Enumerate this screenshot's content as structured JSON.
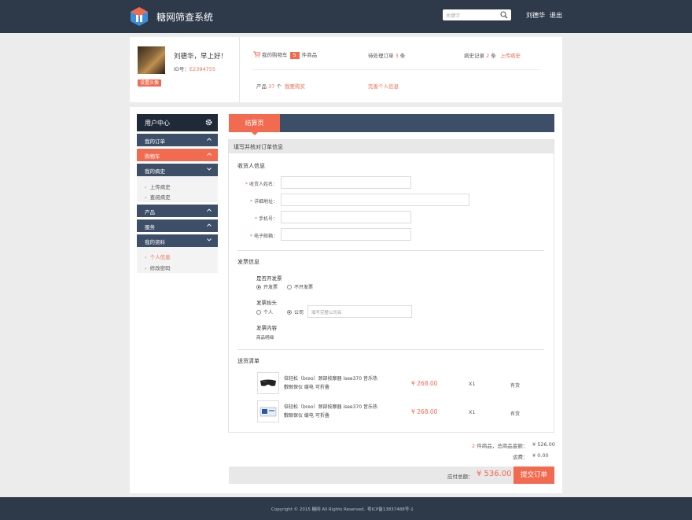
{
  "header": {
    "brand": "糖网筛查系统",
    "search_placeholder": "关键字",
    "username": "刘德华",
    "logout": "退出"
  },
  "profile": {
    "greeting": "刘德华，早上好！",
    "id_label": "ID号：",
    "id_value": "E2394755",
    "set_avatar": "设置头像"
  },
  "stats": {
    "cart_label": "我的购物车",
    "cart_count": "5",
    "cart_suffix": "件商品",
    "pending_label": "待处理订单",
    "pending_count": "3",
    "pending_unit": "条",
    "history_label": "病史记录",
    "history_count": "2",
    "history_unit": "条",
    "upload_link": "上传病史",
    "product_label": "产品",
    "product_count": "37",
    "product_unit": "个",
    "buy_link": "我要购买",
    "complete_link": "完善个人信息"
  },
  "sidebar": {
    "title": "用户中心",
    "items": [
      {
        "label": "我的订单"
      },
      {
        "label": "购物车"
      },
      {
        "label": "我的病史"
      },
      {
        "label": "上传病史"
      },
      {
        "label": "查阅病史"
      },
      {
        "label": "产品"
      },
      {
        "label": "服务"
      },
      {
        "label": "我的资料"
      },
      {
        "label": "个人信息"
      },
      {
        "label": "修改密码"
      }
    ]
  },
  "tab": {
    "label": "结算页"
  },
  "form": {
    "heading": "填写并核对订单信息",
    "receiver_title": "收货人信息",
    "fields": [
      {
        "label": "收货人姓名："
      },
      {
        "label": "详细地址："
      },
      {
        "label": "手机号："
      },
      {
        "label": "电子邮箱："
      }
    ],
    "invoice_title": "发票信息",
    "invoice_q": "是否开发票",
    "opt_yes": "开发票",
    "opt_no": "不开发票",
    "header_q": "发票抬头",
    "opt_personal": "个人",
    "opt_company": "公司",
    "company_placeholder": "填写完整公司名",
    "content_q": "发票内容",
    "content_value": "商品明细"
  },
  "delivery": {
    "title": "送货清单",
    "items": [
      {
        "name_line1": "倍轻松（breo）颈部按摩器 isee370 音乐热",
        "name_line2": "敷眼保仪 缓电 可折叠",
        "price": "¥ 268.00",
        "qty": "X1",
        "stock": "有货"
      },
      {
        "name_line1": "倍轻松（breo）颈部按摩器 isee370 音乐热",
        "name_line2": "敷眼保仪 缓电 可折叠",
        "price": "¥ 268.00",
        "qty": "X1",
        "stock": "有货"
      }
    ]
  },
  "summary": {
    "count": "2",
    "count_text": "件商品，总商品金额：",
    "amount": "¥ 526.00",
    "shipping_label": "运费：",
    "shipping": "¥ 0.00",
    "total_label": "应付总额：",
    "total": "¥ 536.00",
    "submit": "提交订单"
  },
  "footer": {
    "copyright": "Copyright © 2015 糖网 All Rights Reserved.",
    "icp": "粤ICP备13837488号-1"
  },
  "colors": {
    "accent": "#f26b50",
    "navy": "#2e3a4a",
    "menu": "#3d4f68"
  }
}
